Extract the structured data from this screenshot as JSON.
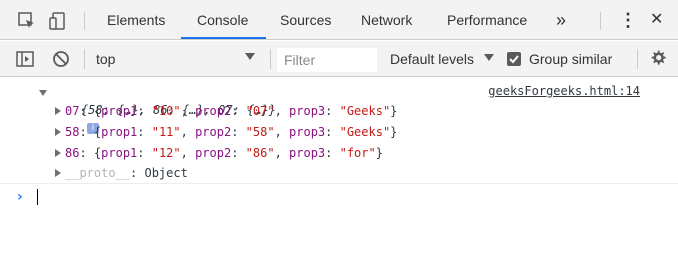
{
  "tabbar": {
    "tabs": [
      {
        "label": "Elements",
        "active": false
      },
      {
        "label": "Console",
        "active": true
      },
      {
        "label": "Sources",
        "active": false
      },
      {
        "label": "Network",
        "active": false
      },
      {
        "label": "Performance",
        "active": false
      }
    ],
    "more_label": "»",
    "kebab_label": "⋮",
    "close_label": "✕"
  },
  "toolbar": {
    "context": "top",
    "filter_placeholder": "Filter",
    "levels_label": "Default levels",
    "group_similar_label": "Group similar",
    "group_similar_checked": true
  },
  "console": {
    "object_summary": "{58: {…}, 86: {…}, 07: {…}}",
    "info_badge": "i",
    "source_link": "geeksForgeeks.html:14",
    "entries": [
      {
        "key": "07",
        "p1": "\"10\"",
        "p2": "\"07\"",
        "p3": "\"Geeks\""
      },
      {
        "key": "58",
        "p1": "\"11\"",
        "p2": "\"58\"",
        "p3": "\"Geeks\""
      },
      {
        "key": "86",
        "p1": "\"12\"",
        "p2": "\"86\"",
        "p3": "\"for\""
      }
    ],
    "proto_key": "__proto__",
    "proto_value": "Object",
    "prompt": "›"
  },
  "colors": {
    "accent": "#1a73e8",
    "string": "#c41a16",
    "key": "#881280",
    "prompt": "#367cf1"
  }
}
